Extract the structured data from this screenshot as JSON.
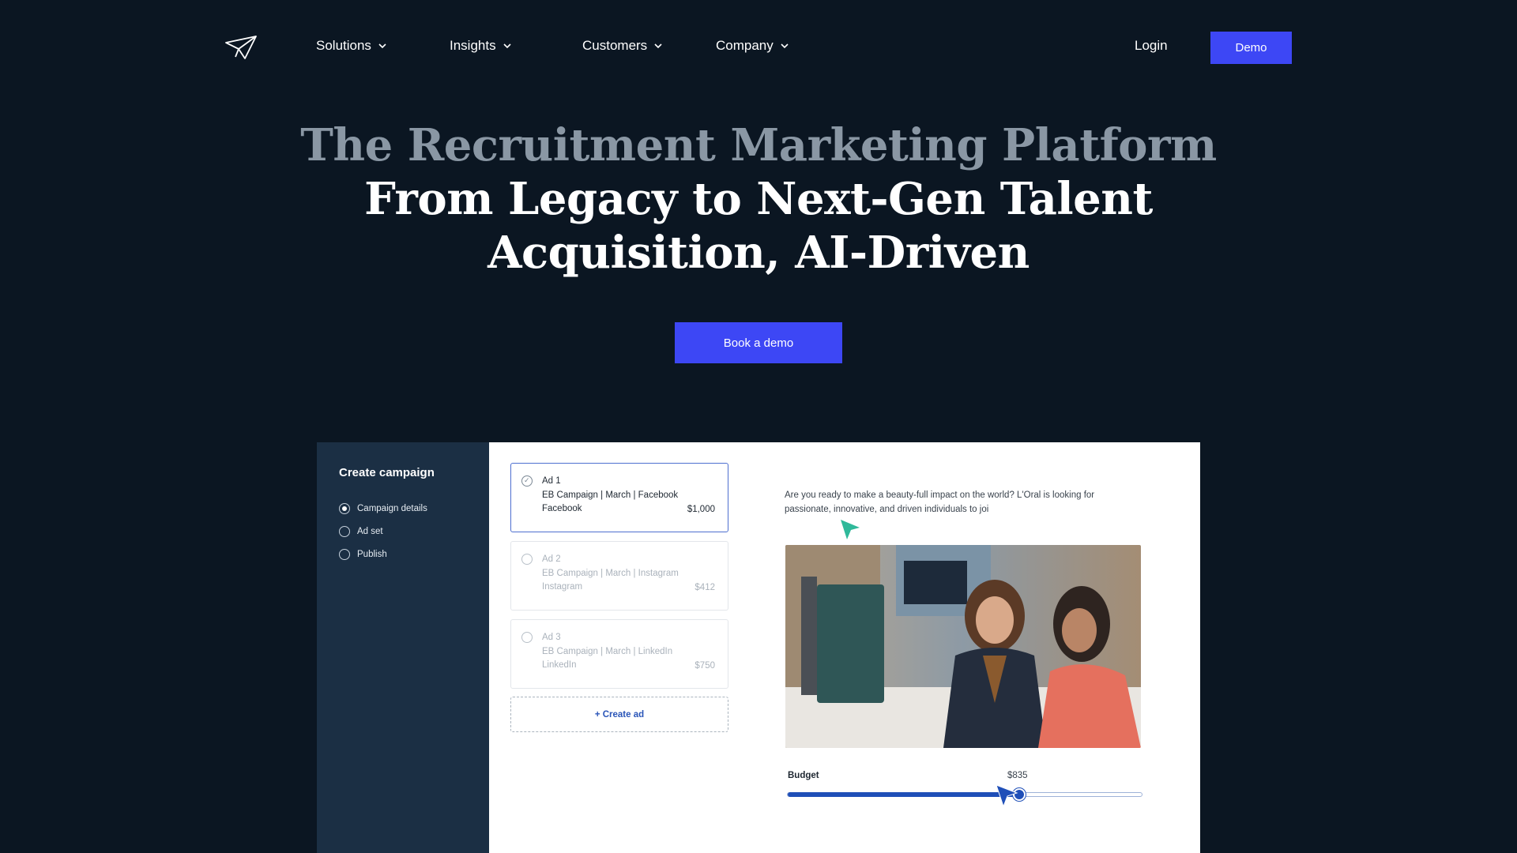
{
  "nav": {
    "items": [
      {
        "label": "Solutions"
      },
      {
        "label": "Insights"
      },
      {
        "label": "Customers"
      },
      {
        "label": "Company"
      }
    ],
    "login_label": "Login",
    "demo_label": "Demo"
  },
  "hero": {
    "line1": "The Recruitment Marketing Platform",
    "line2": "From Legacy to Next-Gen Talent",
    "line3": "Acquisition, AI-Driven",
    "cta_label": "Book a demo"
  },
  "app": {
    "sidebar": {
      "title": "Create campaign",
      "steps": [
        {
          "label": "Campaign details",
          "selected": true
        },
        {
          "label": "Ad set",
          "selected": false
        },
        {
          "label": "Publish",
          "selected": false
        }
      ]
    },
    "ads": [
      {
        "title": "Ad 1",
        "campaign": "EB Campaign | March | Facebook",
        "platform": "Facebook",
        "price": "$1,000",
        "active": true
      },
      {
        "title": "Ad 2",
        "campaign": "EB Campaign | March | Instagram",
        "platform": "Instagram",
        "price": "$412",
        "active": false
      },
      {
        "title": "Ad 3",
        "campaign": "EB Campaign | March | LinkedIn",
        "platform": "LinkedIn",
        "price": "$750",
        "active": false
      }
    ],
    "create_ad_label": "+ Create ad",
    "ad_copy": "Are you ready to make a beauty-full impact on the world? L'Oral is looking for passionate, innovative, and driven individuals to joi",
    "budget": {
      "label": "Budget",
      "value": "$835",
      "fraction": 0.65
    }
  },
  "colors": {
    "background": "#0b1622",
    "accent": "#3d47f5",
    "sidebar": "#1b2f44",
    "slider": "#1f4fb8",
    "muted_headline": "#8a97a4"
  }
}
